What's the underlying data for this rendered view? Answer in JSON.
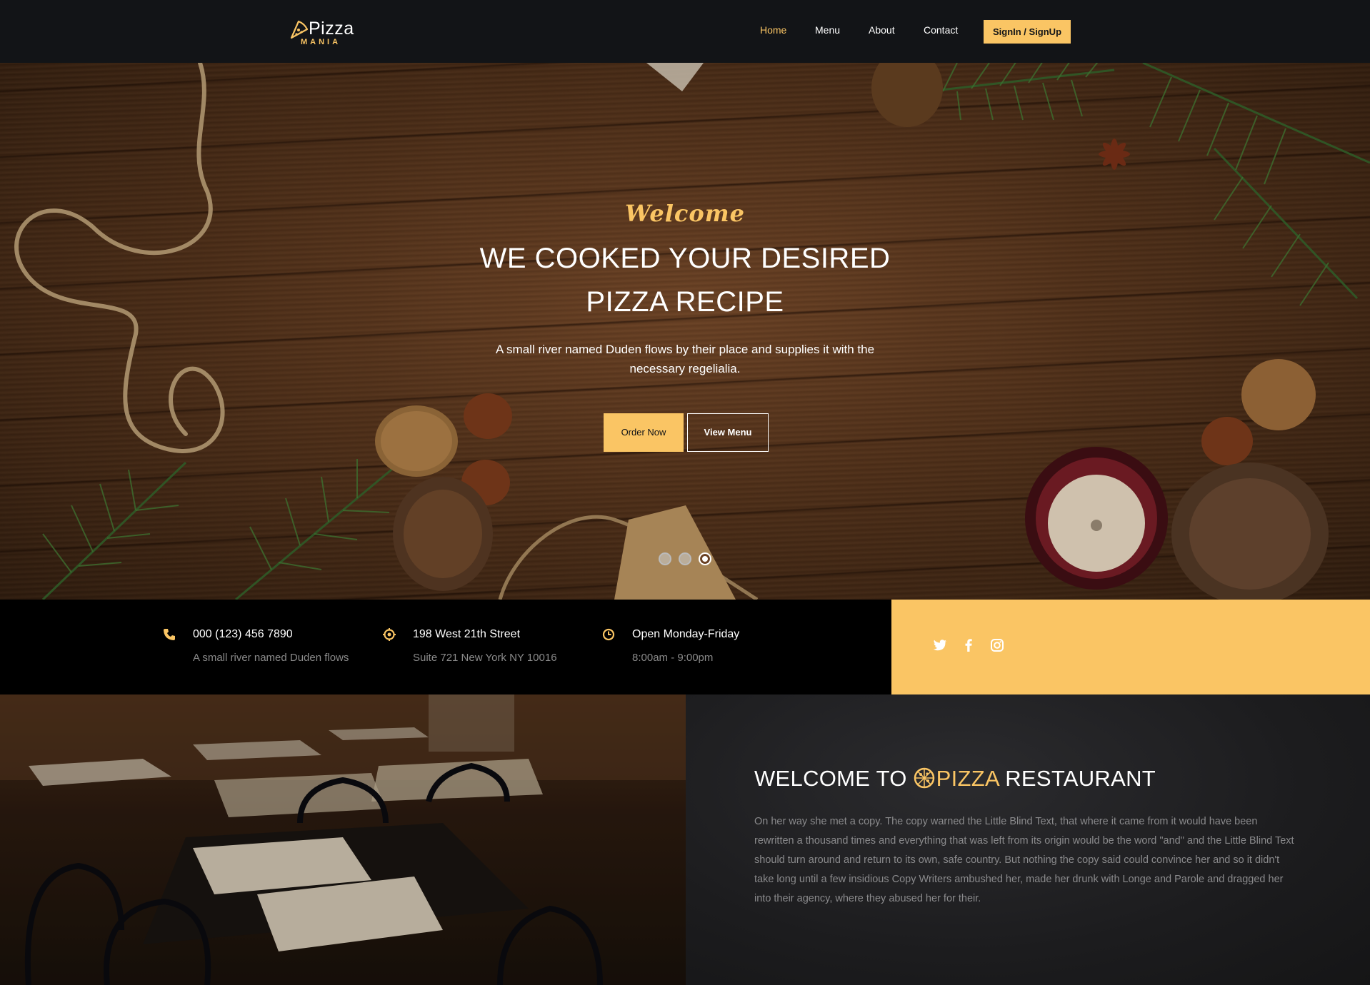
{
  "nav": {
    "logo_word": "Pizza",
    "logo_sub": "MANIA",
    "links": [
      "Home",
      "Menu",
      "About",
      "Contact"
    ],
    "signin_label": "SignIn / SignUp"
  },
  "hero": {
    "welcome": "Welcome",
    "title_line1": "WE COOKED YOUR DESIRED",
    "title_line2": "PIZZA RECIPE",
    "text": "A small river named Duden flows by their place and supplies it with the necessary regelialia.",
    "order_label": "Order Now",
    "menu_label": "View Menu",
    "slides_count": 3,
    "active_slide": 3
  },
  "info": {
    "phone_title": "000 (123) 456 7890",
    "phone_sub": "A small river named Duden flows",
    "address_title": "198 West 21th Street",
    "address_sub": "Suite 721 New York NY 10016",
    "hours_title": "Open Monday-Friday",
    "hours_sub": "8:00am - 9:00pm",
    "icons": [
      "phone-icon",
      "location-icon",
      "clock-icon"
    ]
  },
  "social": [
    "twitter-icon",
    "facebook-icon",
    "instagram-icon"
  ],
  "about": {
    "title_prefix": "WELCOME TO ",
    "title_highlight": "PIZZA",
    "title_suffix": " RESTAURANT",
    "text": "On her way she met a copy. The copy warned the Little Blind Text, that where it came from it would have been rewritten a thousand times and everything that was left from its origin would be the word \"and\" and the Little Blind Text should turn around and return to its own, safe country. But nothing the copy said could convince her and so it didn't take long until a few insidious Copy Writers ambushed her, made her drunk with Longe and Parole and dragged her into their agency, where they abused her for their."
  },
  "colors": {
    "accent": "#fac564",
    "nav_bg": "#121417",
    "info_bg": "#000000"
  }
}
